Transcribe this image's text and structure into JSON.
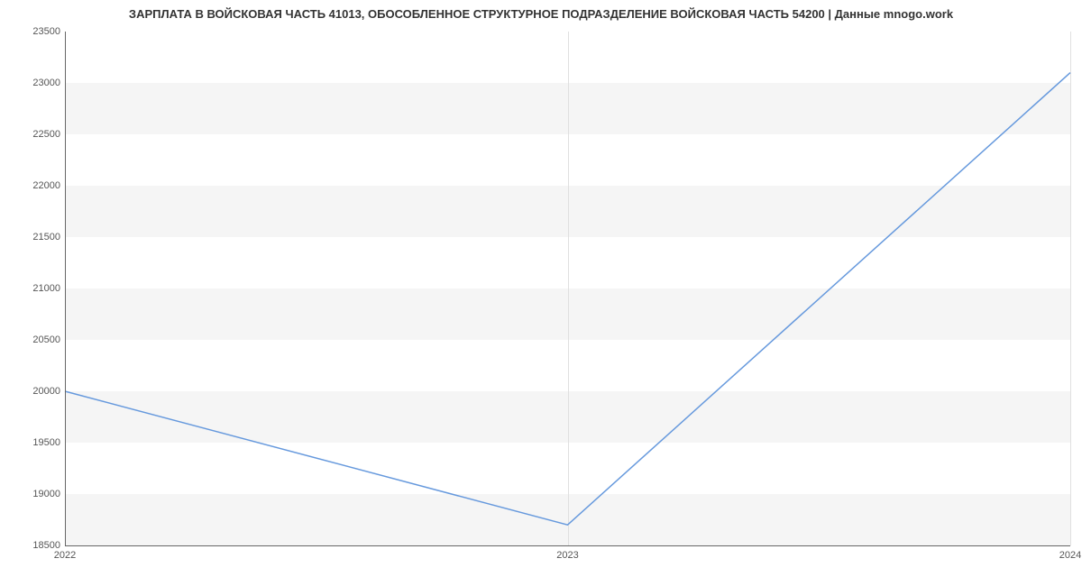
{
  "chart_data": {
    "type": "line",
    "title": "ЗАРПЛАТА В  ВОЙСКОВАЯ ЧАСТЬ 41013, ОБОСОБЛЕННОЕ  СТРУКТУРНОЕ ПОДРАЗДЕЛЕНИЕ ВОЙСКОВАЯ ЧАСТЬ 54200 | Данные mnogo.work",
    "x": [
      2022,
      2023,
      2024
    ],
    "values": [
      20000,
      18700,
      23100
    ],
    "xlabel": "",
    "ylabel": "",
    "ylim": [
      18500,
      23500
    ],
    "xlim": [
      2022,
      2024
    ],
    "y_ticks": [
      18500,
      19000,
      19500,
      20000,
      20500,
      21000,
      21500,
      22000,
      22500,
      23000,
      23500
    ],
    "x_ticks": [
      2022,
      2023,
      2024
    ]
  }
}
